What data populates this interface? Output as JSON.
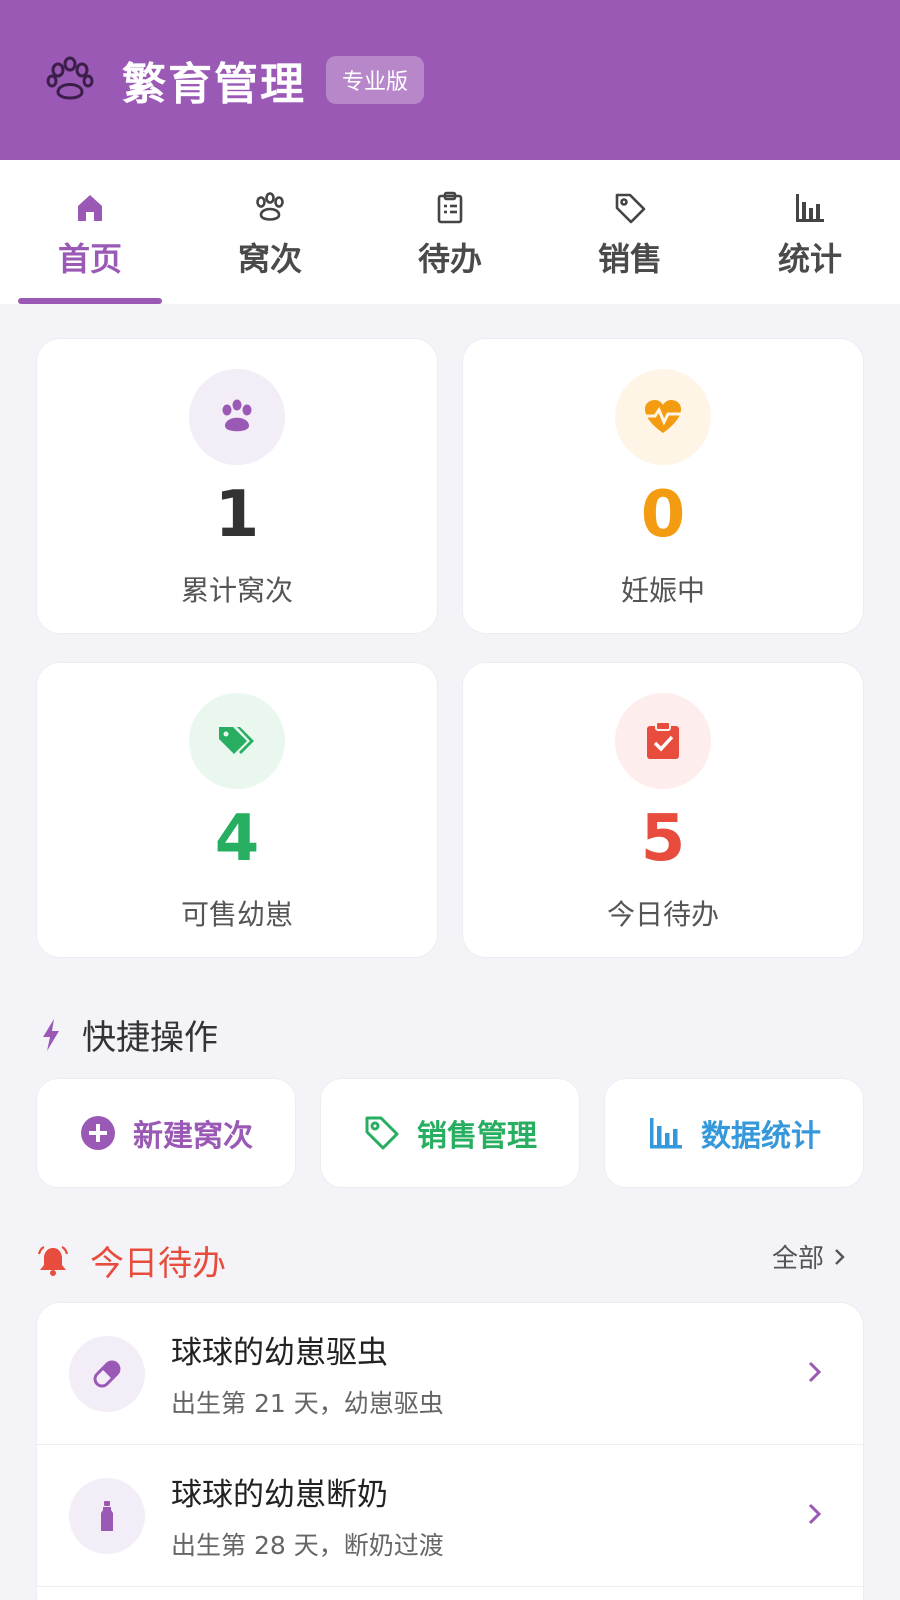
{
  "header": {
    "title": "繁育管理",
    "badge": "专业版"
  },
  "tabs": [
    {
      "label": "首页",
      "icon": "home-icon",
      "active": true
    },
    {
      "label": "窝次",
      "icon": "paw-icon",
      "active": false
    },
    {
      "label": "待办",
      "icon": "clipboard-icon",
      "active": false
    },
    {
      "label": "销售",
      "icon": "tag-icon",
      "active": false
    },
    {
      "label": "统计",
      "icon": "bar-chart-icon",
      "active": false
    }
  ],
  "stats": [
    {
      "value": "1",
      "label": "累计窝次",
      "icon": "paw-icon",
      "color": "#333333",
      "bg": "#f3edf7",
      "icon_color": "#9b59b6"
    },
    {
      "value": "0",
      "label": "妊娠中",
      "icon": "heartbeat-icon",
      "color": "#f39c12",
      "bg": "#fef5e7",
      "icon_color": "#f39c12"
    },
    {
      "value": "4",
      "label": "可售幼崽",
      "icon": "tags-icon",
      "color": "#27ae60",
      "bg": "#e9f7ef",
      "icon_color": "#27ae60"
    },
    {
      "value": "5",
      "label": "今日待办",
      "icon": "clipboard-check-icon",
      "color": "#e74c3c",
      "bg": "#fdedec",
      "icon_color": "#e74c3c"
    }
  ],
  "quick_actions": {
    "title": "快捷操作",
    "items": [
      {
        "label": "新建窝次",
        "icon": "plus-circle-icon",
        "color": "#9b59b6"
      },
      {
        "label": "销售管理",
        "icon": "tag-icon",
        "color": "#27ae60"
      },
      {
        "label": "数据统计",
        "icon": "bar-chart-icon",
        "color": "#3498db"
      }
    ]
  },
  "today_todo": {
    "title": "今日待办",
    "all_label": "全部",
    "title_color": "#e74c3c",
    "items": [
      {
        "title": "球球的幼崽驱虫",
        "subtitle": "出生第 21 天，幼崽驱虫",
        "icon": "pill-icon"
      },
      {
        "title": "球球的幼崽断奶",
        "subtitle": "出生第 28 天，断奶过渡",
        "icon": "bottle-icon"
      }
    ]
  }
}
